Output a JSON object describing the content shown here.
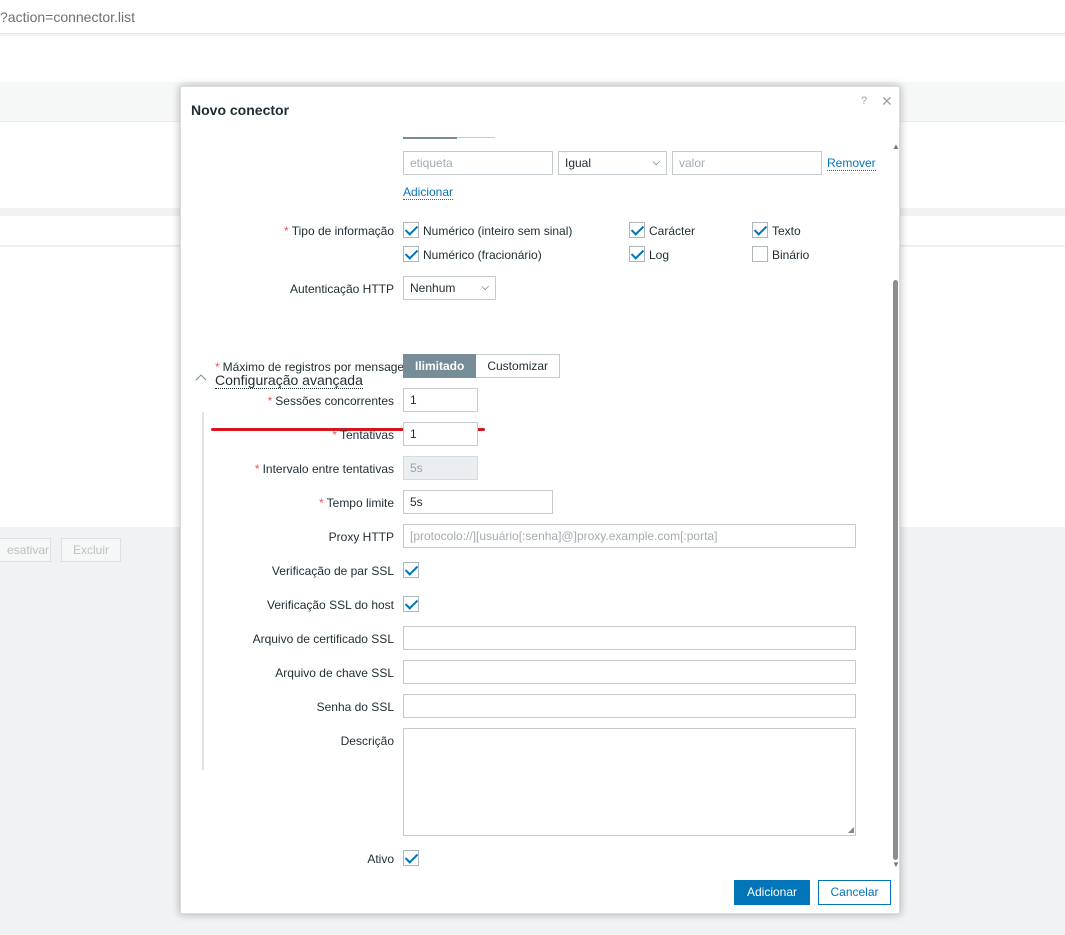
{
  "browser": {
    "url_text": "?action=connector.list"
  },
  "background": {
    "disable_label": "esativar",
    "delete_label": "Excluir"
  },
  "dialog": {
    "title": "Novo conector",
    "help_glyph": "?",
    "close_glyph": "✕",
    "tags": {
      "tag_placeholder": "etiqueta",
      "operator_value": "Igual",
      "value_placeholder": "valor",
      "remove_label": "Remover",
      "add_label": "Adicionar"
    },
    "info_type": {
      "label": "Tipo de informação",
      "options": [
        {
          "label": "Numérico (inteiro sem sinal)",
          "checked": true
        },
        {
          "label": "Carácter",
          "checked": true
        },
        {
          "label": "Texto",
          "checked": true
        },
        {
          "label": "Numérico (fracionário)",
          "checked": true
        },
        {
          "label": "Log",
          "checked": true
        },
        {
          "label": "Binário",
          "checked": false
        }
      ]
    },
    "http_auth": {
      "label": "Autenticação HTTP",
      "value": "Nenhum"
    },
    "advanced": {
      "header": "Configuração avançada",
      "max_records": {
        "label": "Máximo de registros por mensagem",
        "options": [
          "Ilimitado",
          "Customizar"
        ],
        "selected": "Ilimitado"
      },
      "concurrent_sessions": {
        "label": "Sessões concorrentes",
        "value": "1"
      },
      "attempts": {
        "label": "Tentativas",
        "value": "1"
      },
      "attempt_interval": {
        "label": "Intervalo entre tentativas",
        "value": "5s"
      },
      "timeout": {
        "label": "Tempo limite",
        "value": "5s"
      },
      "proxy": {
        "label": "Proxy HTTP",
        "placeholder": "[protocolo://][usuário[:senha]@]proxy.example.com[:porta]"
      },
      "ssl_peer": {
        "label": "Verificação de par SSL",
        "checked": true
      },
      "ssl_host": {
        "label": "Verificação SSL do host",
        "checked": true
      },
      "ssl_cert": {
        "label": "Arquivo de certificado SSL",
        "value": ""
      },
      "ssl_key": {
        "label": "Arquivo de chave SSL",
        "value": ""
      },
      "ssl_password": {
        "label": "Senha do SSL",
        "value": ""
      }
    },
    "description": {
      "label": "Descrição",
      "value": ""
    },
    "active": {
      "label": "Ativo",
      "checked": true
    },
    "buttons": {
      "add": "Adicionar",
      "cancel": "Cancelar"
    }
  }
}
